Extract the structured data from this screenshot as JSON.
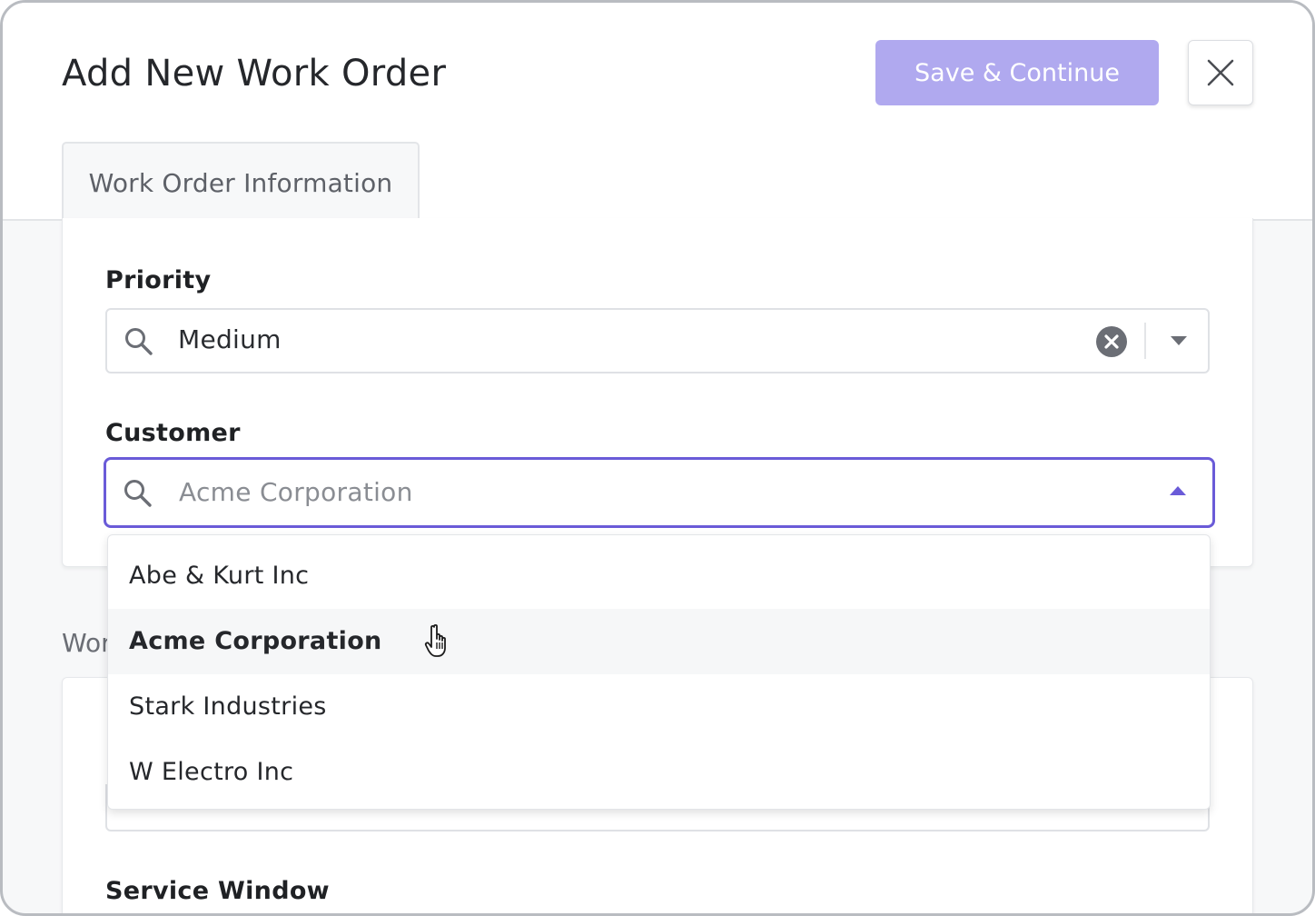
{
  "modal": {
    "title": "Add New Work Order",
    "save_label": "Save & Continue",
    "tab_label": "Work Order Information"
  },
  "priority": {
    "label": "Priority",
    "value": "Medium"
  },
  "customer": {
    "label": "Customer",
    "placeholder": "Acme Corporation",
    "options": [
      "Abe & Kurt Inc",
      "Acme Corporation",
      "Stark Industries",
      "W Electro Inc"
    ],
    "hovered_option": "Acme Corporation"
  },
  "section2": {
    "label_partial": "Wor",
    "service_window_label": "Service Window"
  },
  "colors": {
    "accent": "#6a5bd8",
    "save_button": "#b0a9ef"
  },
  "icons": {
    "close": "close-icon",
    "search": "search-icon",
    "clear": "clear-circle-icon",
    "caret_down": "caret-down-icon",
    "caret_up": "caret-up-icon",
    "cursor": "hand-pointer-icon"
  }
}
